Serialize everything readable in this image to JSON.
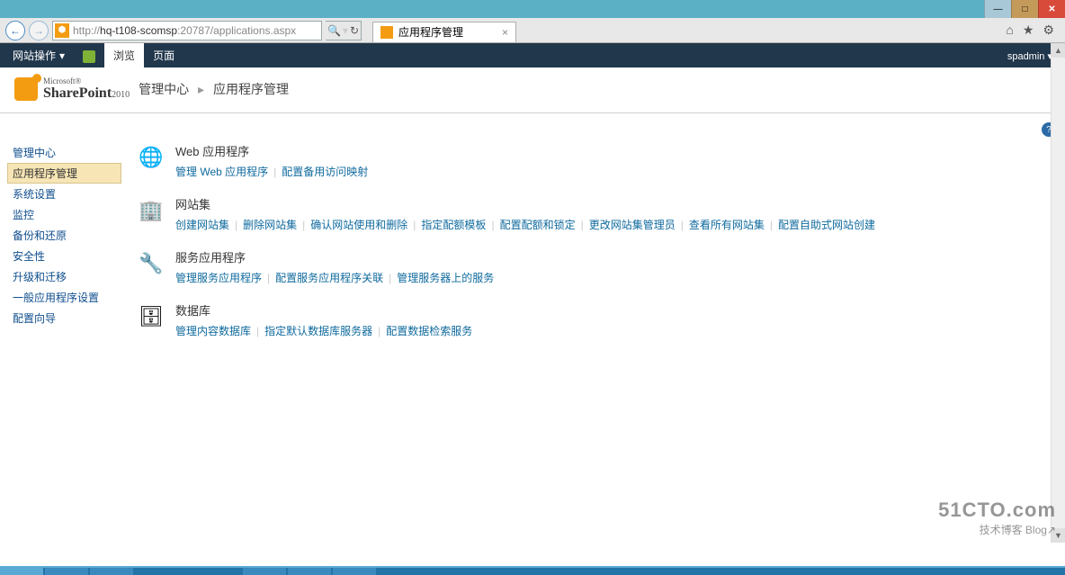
{
  "window": {
    "min": "—",
    "max": "□",
    "close": "✕"
  },
  "ie": {
    "url_prefix": "http://",
    "url_host": "hq-t108-scomsp",
    "url_rest": ":20787/applications.aspx",
    "tab_title": "应用程序管理",
    "search_glyph": "🔍",
    "refresh_glyph": "↻",
    "home_glyph": "⌂",
    "star_glyph": "★",
    "gear_glyph": "⚙"
  },
  "ribbon": {
    "site_actions": "网站操作",
    "browse": "浏览",
    "page": "页面",
    "user": "spadmin",
    "dropdown": "▾"
  },
  "logo": {
    "ms": "Microsoft®",
    "sp": "SharePoint",
    "yr": "2010"
  },
  "breadcrumb": {
    "link1": "管理中心",
    "sep": "▸",
    "current": "应用程序管理"
  },
  "help": "?",
  "sidebar": {
    "items": [
      "管理中心",
      "应用程序管理",
      "系统设置",
      "监控",
      "备份和还原",
      "安全性",
      "升级和迁移",
      "一般应用程序设置",
      "配置向导"
    ]
  },
  "sections": [
    {
      "icon": "🌐",
      "title": "Web 应用程序",
      "links": [
        "管理 Web 应用程序",
        "配置备用访问映射"
      ]
    },
    {
      "icon": "🏢",
      "title": "网站集",
      "links": [
        "创建网站集",
        "删除网站集",
        "确认网站使用和删除",
        "指定配额模板",
        "配置配额和锁定",
        "更改网站集管理员",
        "查看所有网站集",
        "配置自助式网站创建"
      ]
    },
    {
      "icon": "🔧",
      "title": "服务应用程序",
      "links": [
        "管理服务应用程序",
        "配置服务应用程序关联",
        "管理服务器上的服务"
      ]
    },
    {
      "icon": "🗄",
      "title": "数据库",
      "links": [
        "管理内容数据库",
        "指定默认数据库服务器",
        "配置数据检索服务"
      ]
    }
  ],
  "watermark": {
    "big": "51CTO.com",
    "small": "技术博客  Blog↗"
  }
}
